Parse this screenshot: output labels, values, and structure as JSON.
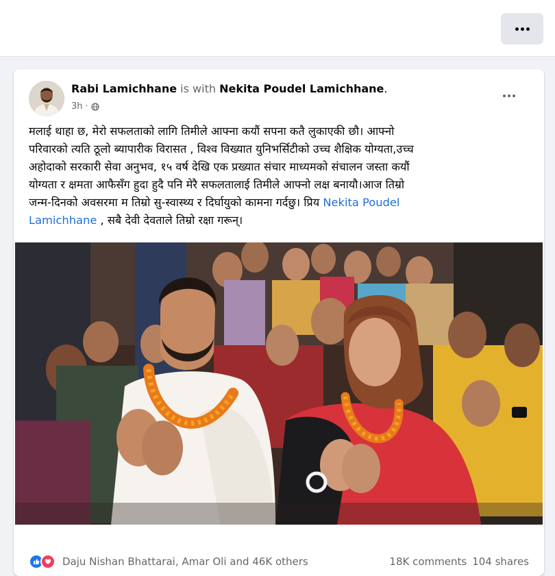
{
  "post": {
    "author": "Rabi Lamichhane",
    "with_text": "is with",
    "tagged": "Nekita Poudel Lamichhane",
    "period": ".",
    "time": "3h",
    "audience_icon": "globe-icon",
    "text_lines": [
      "मलाई थाहा छ, मेरो सफलताको लागि तिमीले  आफ्ना कयौं सपना कतै लुकाएकी छौ। आफ्नो",
      "परिवारको त्यति ठूलो ब्यापारीक विरासत , विश्व विख्यात  युनिभर्सिटीको उच्च शैक्षिक योग्यता,उच्च",
      "अहोदाको सरकारी सेवा अनुभव, १५ वर्ष देखि एक प्रख्यात संचार माध्यमको संचालन जस्ता कयौं",
      "योग्यता र क्षमता आफैसँग हुदा हुदै  पनि मेरै सफलतालाई तिमीले आफ्नो लक्ष बनायौ।आज तिम्रो",
      "जन्म-दिनको अवसरमा म तिम्रो सु-स्वास्थ्य र दिर्घायुको कामना गर्दछु। प्रिय"
    ],
    "mention_part1": "Nekita Poudel",
    "mention_part2": "Lamichhane",
    "text_end": " , सबै देवी देवताले तिम्रो  रक्षा गरून्।",
    "reactions": {
      "icons": [
        "like-icon",
        "love-icon"
      ],
      "names": "Daju Nishan Bhattarai, Amar Oli and 46K others",
      "comments": "18K comments",
      "shares": "104 shares"
    }
  },
  "colors": {
    "link": "#216fdb",
    "like": "#1877f2",
    "love": "#f33e58",
    "secondary": "#65676b",
    "background": "#f0f2f5"
  }
}
